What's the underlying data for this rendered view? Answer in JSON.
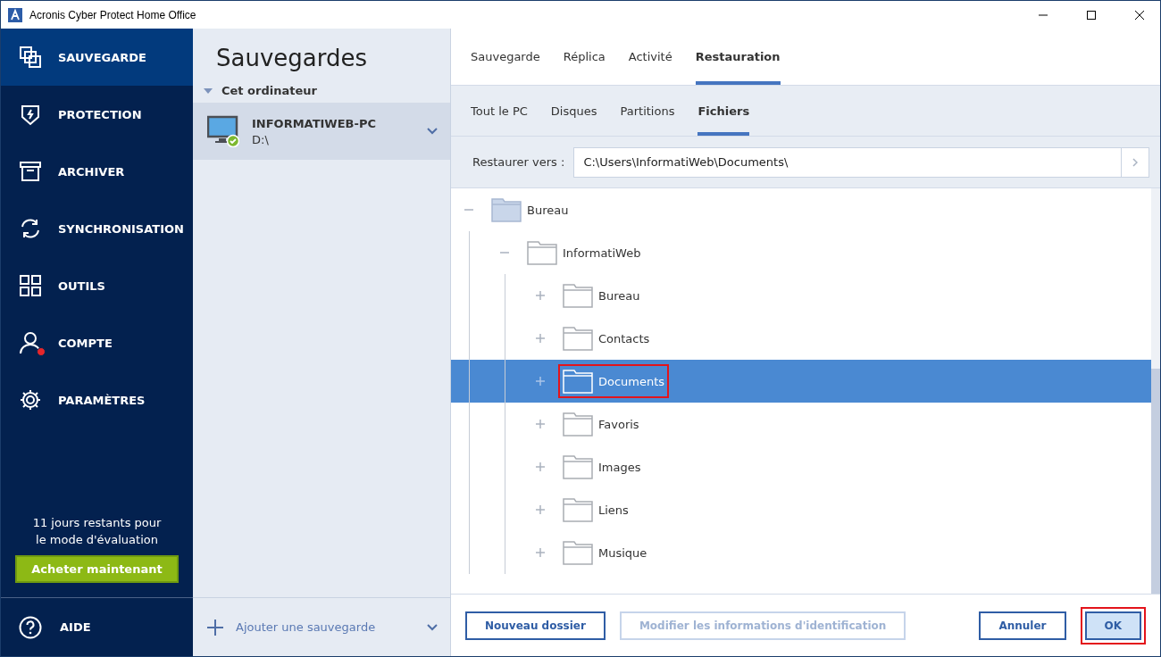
{
  "window": {
    "title": "Acronis Cyber Protect Home Office"
  },
  "sidebar": {
    "items": [
      {
        "label": "SAUVEGARDE",
        "selected": true,
        "badge": false
      },
      {
        "label": "PROTECTION",
        "selected": false,
        "badge": false
      },
      {
        "label": "ARCHIVER",
        "selected": false,
        "badge": false
      },
      {
        "label": "SYNCHRONISATION",
        "selected": false,
        "badge": false
      },
      {
        "label": "OUTILS",
        "selected": false,
        "badge": false
      },
      {
        "label": "COMPTE",
        "selected": false,
        "badge": true
      },
      {
        "label": "PARAMÈTRES",
        "selected": false,
        "badge": false
      }
    ],
    "trial_text": "11 jours restants pour le mode d'évaluation",
    "buy_button": "Acheter maintenant",
    "help": "AIDE"
  },
  "backups": {
    "title": "Sauvegardes",
    "group": {
      "label": "Cet ordinateur",
      "expanded": true
    },
    "items": [
      {
        "name": "INFORMATIWEB-PC",
        "location": "D:\\",
        "selected": true
      }
    ],
    "add_label": "Ajouter une sauvegarde"
  },
  "tabs": [
    {
      "label": "Sauvegarde",
      "selected": false
    },
    {
      "label": "Réplica",
      "selected": false
    },
    {
      "label": "Activité",
      "selected": false
    },
    {
      "label": "Restauration",
      "selected": true
    }
  ],
  "subtabs": [
    {
      "label": "Tout le PC",
      "selected": false
    },
    {
      "label": "Disques",
      "selected": false
    },
    {
      "label": "Partitions",
      "selected": false
    },
    {
      "label": "Fichiers",
      "selected": true
    }
  ],
  "restore_to": {
    "label": "Restaurer vers :",
    "value": "C:\\Users\\InformatiWeb\\Documents\\"
  },
  "tree": [
    {
      "label": "Bureau",
      "expanded": true,
      "selected": false,
      "highlighted": false,
      "children": [
        {
          "label": "InformatiWeb",
          "expanded": true,
          "selected": false,
          "highlighted": false,
          "children": [
            {
              "label": "Bureau",
              "expanded": false,
              "selected": false,
              "highlighted": false
            },
            {
              "label": "Contacts",
              "expanded": false,
              "selected": false,
              "highlighted": false
            },
            {
              "label": "Documents",
              "expanded": false,
              "selected": true,
              "highlighted": true
            },
            {
              "label": "Favoris",
              "expanded": false,
              "selected": false,
              "highlighted": false
            },
            {
              "label": "Images",
              "expanded": false,
              "selected": false,
              "highlighted": false
            },
            {
              "label": "Liens",
              "expanded": false,
              "selected": false,
              "highlighted": false
            },
            {
              "label": "Musique",
              "expanded": false,
              "selected": false,
              "highlighted": false
            }
          ]
        }
      ]
    }
  ],
  "footer": {
    "buttons": [
      {
        "label": "Nouveau dossier",
        "kind": "outline",
        "disabled": false,
        "highlighted": false
      },
      {
        "label": "Modifier les informations d'identification",
        "kind": "outline",
        "disabled": true,
        "highlighted": false
      },
      {
        "label": "Annuler",
        "kind": "outline",
        "disabled": false,
        "highlighted": false
      },
      {
        "label": "OK",
        "kind": "primary",
        "disabled": false,
        "highlighted": true
      }
    ]
  }
}
